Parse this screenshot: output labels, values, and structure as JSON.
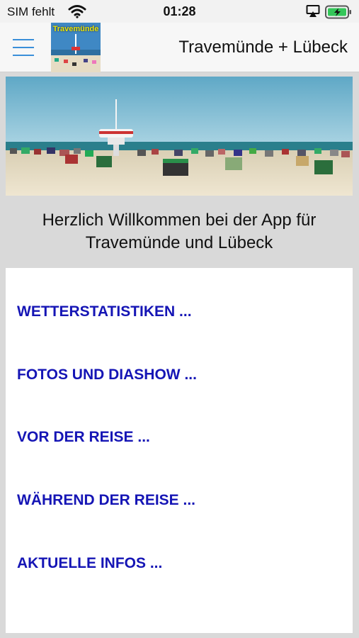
{
  "status": {
    "carrier": "SIM fehlt",
    "time": "01:28",
    "icons": [
      "wifi-icon",
      "airplay-icon",
      "battery-charging-icon"
    ]
  },
  "header": {
    "logo_text": "Travemünde",
    "title": "Travemünde + Lübeck"
  },
  "welcome": {
    "line1": "Herzlich Willkommen bei der App für",
    "line2": "Travemünde und Lübeck"
  },
  "menu": {
    "items": [
      {
        "label": "WETTERSTATISTIKEN ..."
      },
      {
        "label": "FOTOS UND DIASHOW ..."
      },
      {
        "label": "VOR DER REISE ..."
      },
      {
        "label": "WÄHREND DER REISE ..."
      },
      {
        "label": "AKTUELLE INFOS ..."
      }
    ]
  },
  "colors": {
    "link": "#1515b5",
    "accent": "#3a8fd9",
    "battery": "#34c759",
    "background": "#d9d9d9"
  }
}
